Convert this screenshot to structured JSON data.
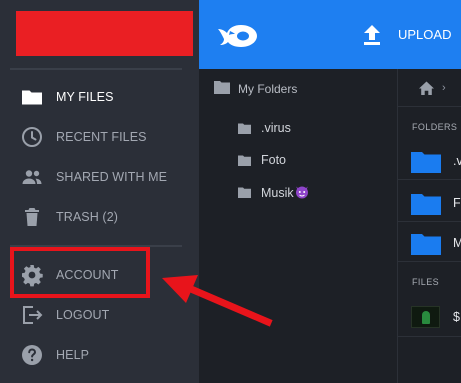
{
  "sidebar": {
    "items": [
      {
        "label": "MY FILES",
        "icon": "folder-icon",
        "active": true
      },
      {
        "label": "RECENT FILES",
        "icon": "clock-icon"
      },
      {
        "label": "SHARED WITH ME",
        "icon": "people-icon"
      },
      {
        "label": "TRASH (2)",
        "icon": "trash-icon"
      },
      {
        "label": "ACCOUNT",
        "icon": "gear-icon"
      },
      {
        "label": "LOGOUT",
        "icon": "logout-icon"
      },
      {
        "label": "HELP",
        "icon": "help-icon"
      }
    ]
  },
  "topbar": {
    "upload_label": "UPLOAD"
  },
  "tree": {
    "root_label": "My Folders",
    "folders": [
      {
        "label": ".virus"
      },
      {
        "label": "Foto"
      },
      {
        "label": "Musik"
      }
    ]
  },
  "content": {
    "folders_heading": "FOLDERS",
    "folder_rows": [
      {
        "label": ".v"
      },
      {
        "label": "F"
      },
      {
        "label": "M"
      }
    ],
    "files_heading": "FILES",
    "file_rows": [
      {
        "label": "$"
      }
    ]
  },
  "colors": {
    "topbar": "#1e7ff1",
    "sidebar": "#2b2f38",
    "background": "#1d2026",
    "annotation": "#e8141b",
    "redacted_logo": "#ea1f23",
    "folder_blue": "#1a7cf0"
  }
}
